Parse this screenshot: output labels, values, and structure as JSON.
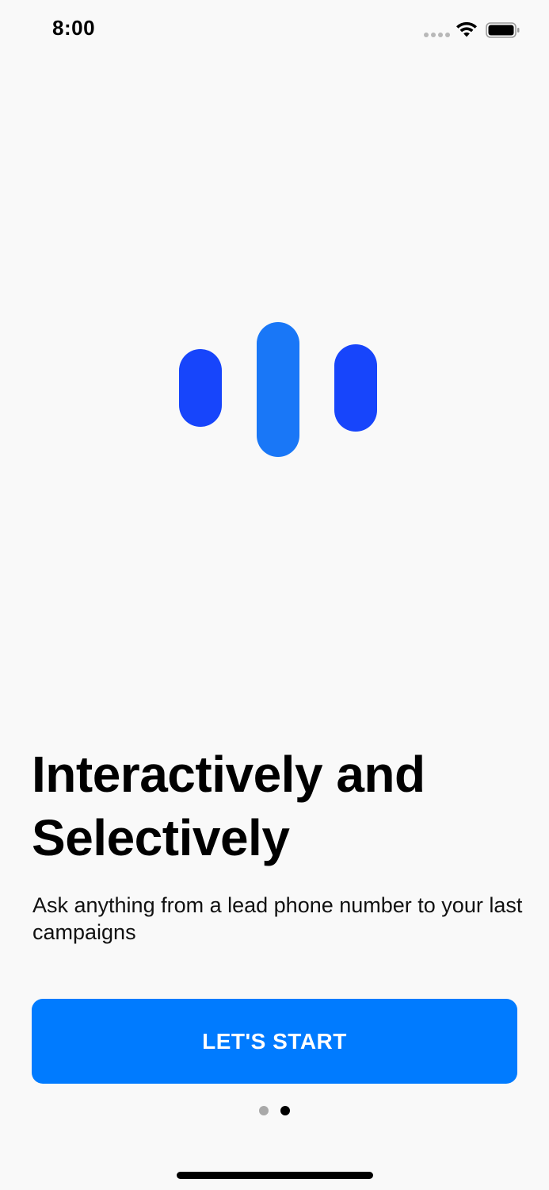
{
  "status_bar": {
    "time": "8:00",
    "icons": [
      "signal-dots-icon",
      "wifi-icon",
      "battery-icon"
    ]
  },
  "logo": {
    "icon": "voice-bars-logo",
    "colors": {
      "outer_bars": "#1745fb",
      "middle_bar": "#1977f7"
    }
  },
  "onboarding": {
    "headline": "Interactively and Selectively",
    "subtitle": "Ask anything from a lead phone number to your last campaigns",
    "cta_label": "LET'S START",
    "page_indicator": {
      "total": 2,
      "current": 2
    }
  },
  "colors": {
    "background": "#f9f9f9",
    "accent": "#007bff",
    "text": "#000000"
  }
}
